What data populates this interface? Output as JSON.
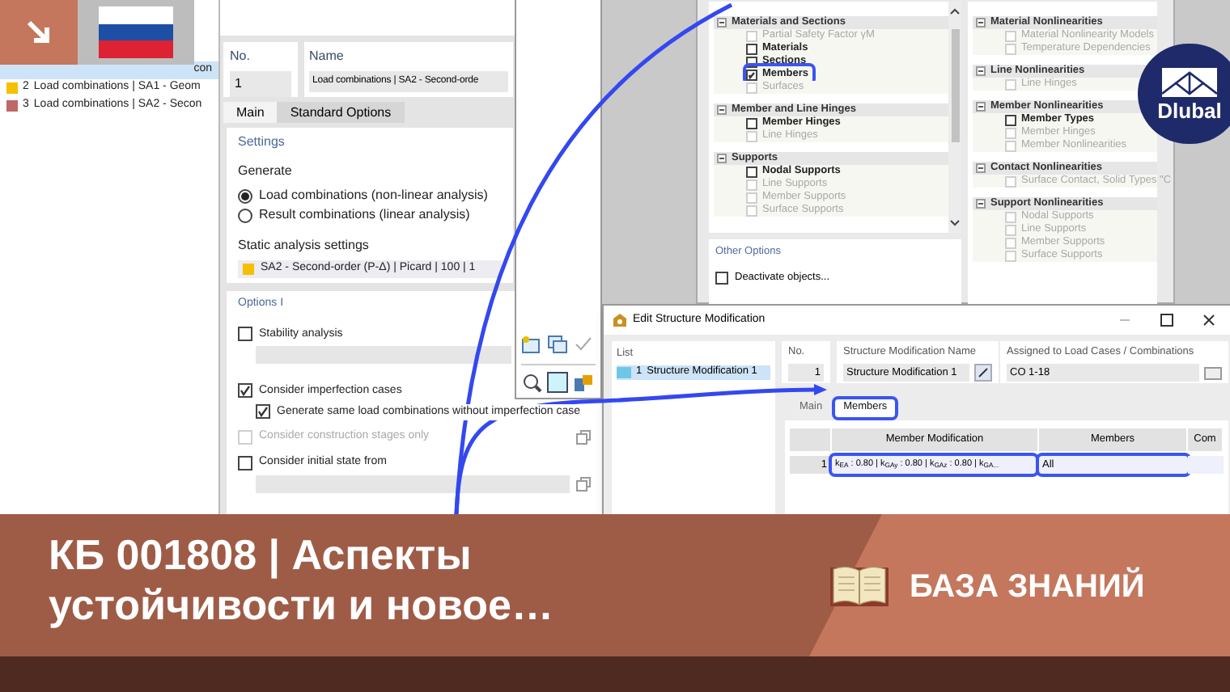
{
  "load_combinations_dialog": {
    "list": [
      {
        "label": "con",
        "selected": true
      },
      {
        "number": "2",
        "label": "Load combinations | SA1 - Geom",
        "selected": false,
        "color": "#f5c000"
      },
      {
        "number": "3",
        "label": "Load combinations | SA2 - Secon",
        "selected": false,
        "color": "#c06868"
      }
    ],
    "no": {
      "label": "No.",
      "value": "1"
    },
    "name": {
      "label": "Name",
      "value": "Load combinations | SA2 - Second-orde"
    },
    "tabs": [
      {
        "label": "Main",
        "selected": true
      },
      {
        "label": "Standard Options",
        "selected": false
      }
    ],
    "settings": {
      "title": "Settings",
      "generate_label": "Generate",
      "options": [
        {
          "label": "Load combinations (non-linear analysis)",
          "selected": true
        },
        {
          "label": "Result combinations (linear analysis)",
          "selected": false
        }
      ],
      "static_label": "Static analysis settings",
      "static_setting": {
        "value": "SA2 - Second-order (P-Δ) | Picard | 100 | 1",
        "color": "#f5c000"
      }
    },
    "options": {
      "title": "Options I",
      "items": [
        {
          "kind": "check",
          "label": "Stability analysis",
          "checked": false,
          "disabled": false,
          "field_below": true
        },
        {
          "kind": "check",
          "label": "Consider imperfection cases",
          "checked": true,
          "disabled": false,
          "field_below": false
        },
        {
          "kind": "subcheck",
          "label": "Generate same load combinations without imperfection case",
          "checked": true,
          "disabled": false,
          "field_below": false
        },
        {
          "kind": "check",
          "label": "Consider construction stages only",
          "checked": false,
          "disabled": true,
          "field_below": false
        },
        {
          "kind": "check",
          "label": "Consider initial state from",
          "checked": false,
          "disabled": false,
          "field_below": true
        }
      ]
    }
  },
  "stiffness_dialog": {
    "left_groups": [
      {
        "label": "Materials and Sections",
        "children": [
          {
            "label": "Partial Safety Factor γM",
            "checked": false,
            "disabled": true,
            "highlighted": false
          },
          {
            "label": "Materials",
            "checked": false,
            "disabled": false,
            "highlighted": false
          },
          {
            "label": "Sections",
            "checked": false,
            "disabled": false,
            "highlighted": false
          },
          {
            "label": "Members",
            "checked": true,
            "disabled": false,
            "highlighted": true
          },
          {
            "label": "Surfaces",
            "checked": false,
            "disabled": true,
            "highlighted": false
          }
        ]
      },
      {
        "label": "Member and Line Hinges",
        "children": [
          {
            "label": "Member Hinges",
            "checked": false,
            "disabled": false,
            "highlighted": false
          },
          {
            "label": "Line Hinges",
            "checked": false,
            "disabled": true,
            "highlighted": false
          }
        ]
      },
      {
        "label": "Supports",
        "children": [
          {
            "label": "Nodal Supports",
            "checked": false,
            "disabled": false,
            "highlighted": false
          },
          {
            "label": "Line Supports",
            "checked": false,
            "disabled": true,
            "highlighted": false
          },
          {
            "label": "Member Supports",
            "checked": false,
            "disabled": true,
            "highlighted": false
          },
          {
            "label": "Surface Supports",
            "checked": false,
            "disabled": true,
            "highlighted": false
          }
        ]
      }
    ],
    "other_options": {
      "title": "Other Options",
      "items": [
        {
          "label": "Deactivate objects...",
          "checked": false
        }
      ]
    },
    "right_groups": [
      {
        "label": "Material Nonlinearities",
        "children": [
          {
            "label": "Material Nonlinearity Models",
            "checked": false,
            "disabled": true
          },
          {
            "label": "Temperature Dependencies",
            "checked": false,
            "disabled": true
          }
        ]
      },
      {
        "label": "Line Nonlinearities",
        "children": [
          {
            "label": "Line Hinges",
            "checked": false,
            "disabled": true
          }
        ]
      },
      {
        "label": "Member Nonlinearities",
        "children": [
          {
            "label": "Member Types",
            "checked": false,
            "disabled": false
          },
          {
            "label": "Member Hinges",
            "checked": false,
            "disabled": true
          },
          {
            "label": "Member Nonlinearities",
            "checked": false,
            "disabled": true
          }
        ]
      },
      {
        "label": "Contact Nonlinearities",
        "children": [
          {
            "label": "Surface Contact, Solid Types \"C",
            "checked": false,
            "disabled": true
          }
        ]
      },
      {
        "label": "Support Nonlinearities",
        "children": [
          {
            "label": "Nodal Supports",
            "checked": false,
            "disabled": true
          },
          {
            "label": "Line Supports",
            "checked": false,
            "disabled": true
          },
          {
            "label": "Member Supports",
            "checked": false,
            "disabled": true
          },
          {
            "label": "Surface Supports",
            "checked": false,
            "disabled": true
          }
        ]
      }
    ]
  },
  "logo": {
    "text": "Dlubal"
  },
  "edit_structure_modification": {
    "title": "Edit Structure Modification",
    "list_label": "List",
    "list_items": [
      {
        "number": "1",
        "label": "Structure Modification 1",
        "selected": true
      }
    ],
    "no": {
      "label": "No.",
      "value": "1"
    },
    "name": {
      "label": "Structure Modification Name",
      "value": "Structure Modification 1"
    },
    "assigned": {
      "label": "Assigned to Load Cases / Combinations",
      "value": "CO 1-18"
    },
    "tabs": [
      {
        "label": "Main",
        "selected": false,
        "highlighted": false
      },
      {
        "label": "Members",
        "selected": true,
        "highlighted": true
      }
    ],
    "table": {
      "columns": [
        "Member Modification",
        "Members",
        "Com"
      ],
      "rows": [
        {
          "number": "1",
          "cells": [
            {
              "text": "k$_{EA}$ : 0.80 | k$_{GAy}$ : 0.80 | k$_{GAz}$ : 0.80 | k$_{GA...}$",
              "highlighted": true
            },
            {
              "text": "All",
              "highlighted": true
            }
          ]
        }
      ]
    }
  },
  "banner": {
    "title": "КБ 001808 | Аспекты устойчивости и новое…",
    "category": "БАЗА ЗНАНИЙ"
  }
}
